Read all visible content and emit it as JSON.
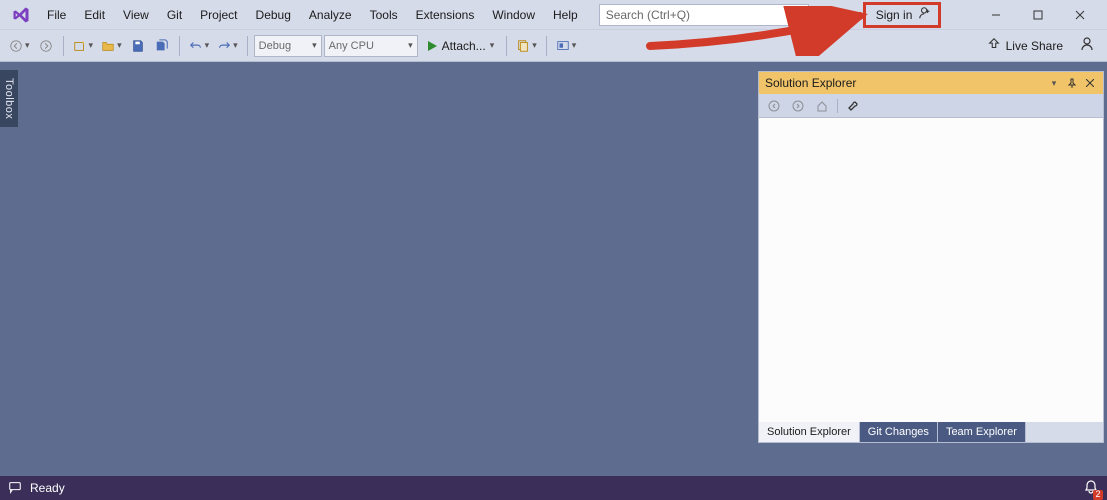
{
  "menubar": {
    "items": [
      "File",
      "Edit",
      "View",
      "Git",
      "Project",
      "Debug",
      "Analyze",
      "Tools",
      "Extensions",
      "Window",
      "Help"
    ],
    "search_placeholder": "Search (Ctrl+Q)",
    "signin_label": "Sign in"
  },
  "toolbar": {
    "config_dropdown": "Debug",
    "platform_dropdown": "Any CPU",
    "attach_label": "Attach...",
    "liveshare_label": "Live Share"
  },
  "sidebar": {
    "toolbox_label": "Toolbox"
  },
  "solution_explorer": {
    "title": "Solution Explorer",
    "tabs": [
      "Solution Explorer",
      "Git Changes",
      "Team Explorer"
    ]
  },
  "statusbar": {
    "ready_label": "Ready",
    "notification_count": "2"
  }
}
